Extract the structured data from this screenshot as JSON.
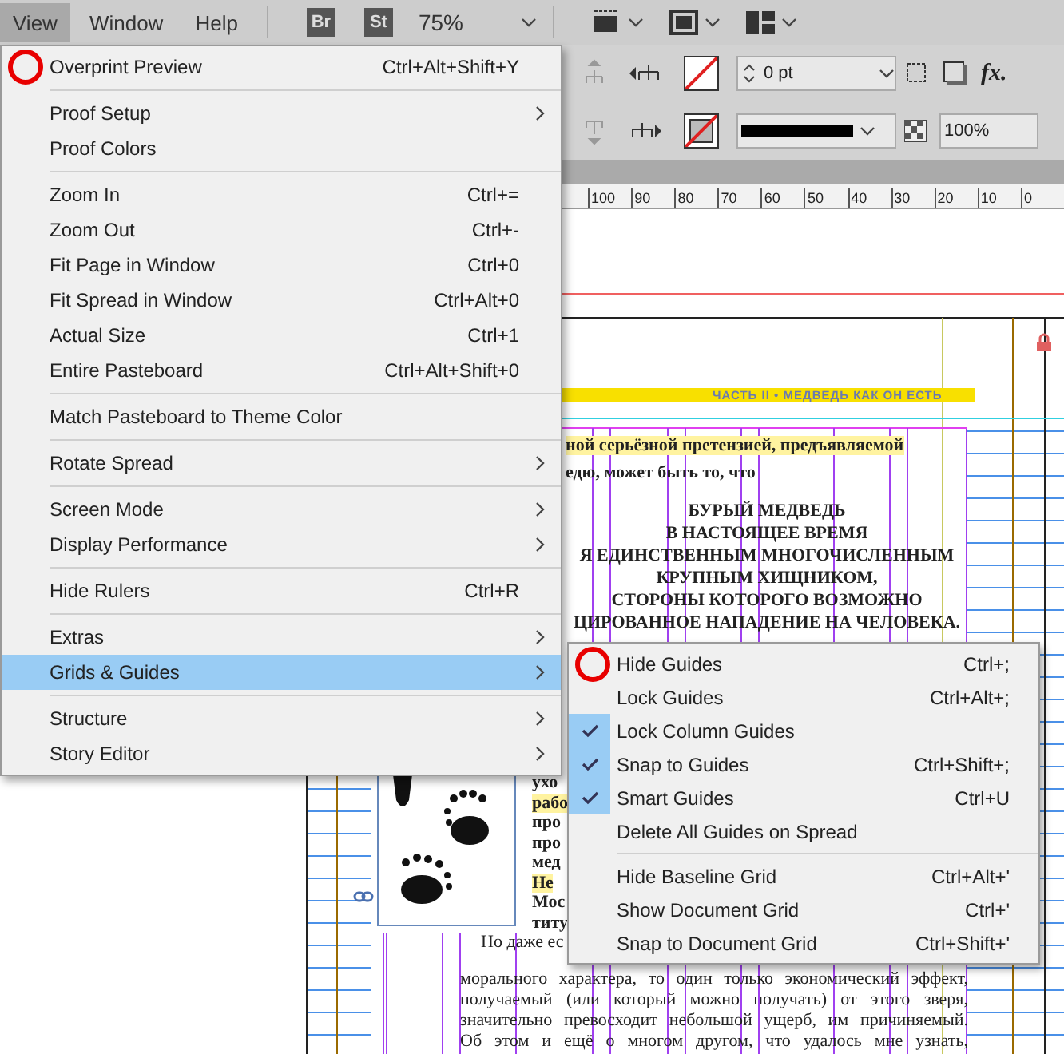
{
  "menubar": [
    {
      "label": "View",
      "selected": true
    },
    {
      "label": "Window",
      "selected": false
    },
    {
      "label": "Help",
      "selected": false
    }
  ],
  "app_bar": {
    "bridge": "Br",
    "stock": "St",
    "zoom": "75%"
  },
  "control_panel": {
    "stroke_weight": "0 pt",
    "opacity": "100%",
    "effects": "fx."
  },
  "ruler": [
    "100",
    "90",
    "80",
    "70",
    "60",
    "50",
    "40",
    "30",
    "20",
    "10",
    "0"
  ],
  "document": {
    "running_head": "ЧАСТЬ II • МЕДВЕДЬ КАК ОН ЕСТЬ",
    "lines": [
      {
        "text": "ной серьёзной претензией, предъявляемой",
        "kind": "para",
        "highlighted": true
      },
      {
        "text": "едю, может быть то, что",
        "kind": "para",
        "highlighted": false
      },
      {
        "text": "БУРЫЙ МЕДВЕДЬ",
        "kind": "heading",
        "highlighted": false
      },
      {
        "text": "В НАСТОЯЩЕЕ ВРЕМЯ",
        "kind": "heading",
        "highlighted": false
      },
      {
        "text": "Я ЕДИНСТВЕННЫМ МНОГОЧИСЛЕННЫМ",
        "kind": "heading",
        "highlighted": false
      },
      {
        "text": "КРУПНЫМ ХИЩНИКОМ,",
        "kind": "heading",
        "highlighted": false
      },
      {
        "text": "СТОРОНЫ КОТОРОГО ВОЗМОЖНО",
        "kind": "heading",
        "highlighted": false
      },
      {
        "text": "ЦИРОВАННОЕ НАПАДЕНИЕ НА ЧЕЛОВЕКА.",
        "kind": "heading",
        "highlighted": false
      }
    ],
    "side_fragments": [
      {
        "text": "ухо",
        "highlighted": false
      },
      {
        "text": "рабо",
        "highlighted": true
      },
      {
        "text": "про",
        "highlighted": false
      },
      {
        "text": "про",
        "highlighted": false
      },
      {
        "text": "мед",
        "highlighted": false
      },
      {
        "text": "Не",
        "highlighted": true
      },
      {
        "text": "Мос",
        "highlighted": false
      },
      {
        "text": "титу",
        "highlighted": false
      }
    ],
    "bottom_lines": [
      "Но даже ес",
      "морального характера, то один только экономический эффект,",
      "получаемый (или который можно получать) от этого зверя,",
      "значительно превосходит небольшой ущерб, им причиняемый.",
      "Об этом и ещё о многом другом, что удалось мне узнать,"
    ]
  },
  "view_menu": {
    "groups": [
      {
        "items": [
          {
            "label": "Overprint Preview",
            "shortcut": "Ctrl+Alt+Shift+Y",
            "submenu": false,
            "selected": false,
            "circled": true
          }
        ]
      },
      {
        "items": [
          {
            "label": "Proof Setup",
            "submenu": true,
            "selected": false,
            "circled": false
          },
          {
            "label": "Proof Colors",
            "submenu": false,
            "selected": false,
            "circled": false
          }
        ]
      },
      {
        "items": [
          {
            "label": "Zoom In",
            "shortcut": "Ctrl+=",
            "submenu": false,
            "selected": false,
            "circled": false
          },
          {
            "label": "Zoom Out",
            "shortcut": "Ctrl+-",
            "submenu": false,
            "selected": false,
            "circled": false
          },
          {
            "label": "Fit Page in Window",
            "shortcut": "Ctrl+0",
            "submenu": false,
            "selected": false,
            "circled": false
          },
          {
            "label": "Fit Spread in Window",
            "shortcut": "Ctrl+Alt+0",
            "submenu": false,
            "selected": false,
            "circled": false
          },
          {
            "label": "Actual Size",
            "shortcut": "Ctrl+1",
            "submenu": false,
            "selected": false,
            "circled": false
          },
          {
            "label": "Entire Pasteboard",
            "shortcut": "Ctrl+Alt+Shift+0",
            "submenu": false,
            "selected": false,
            "circled": false
          }
        ]
      },
      {
        "items": [
          {
            "label": "Match Pasteboard to Theme Color",
            "submenu": false,
            "selected": false,
            "circled": false
          }
        ]
      },
      {
        "items": [
          {
            "label": "Rotate Spread",
            "submenu": true,
            "selected": false,
            "circled": false
          }
        ]
      },
      {
        "items": [
          {
            "label": "Screen Mode",
            "submenu": true,
            "selected": false,
            "circled": false
          },
          {
            "label": "Display Performance",
            "submenu": true,
            "selected": false,
            "circled": false
          }
        ]
      },
      {
        "items": [
          {
            "label": "Hide Rulers",
            "shortcut": "Ctrl+R",
            "submenu": false,
            "selected": false,
            "circled": false
          }
        ]
      },
      {
        "items": [
          {
            "label": "Extras",
            "submenu": true,
            "selected": false,
            "circled": false
          },
          {
            "label": "Grids & Guides",
            "submenu": true,
            "selected": true,
            "circled": false
          }
        ]
      },
      {
        "items": [
          {
            "label": "Structure",
            "submenu": true,
            "selected": false,
            "circled": false
          },
          {
            "label": "Story Editor",
            "submenu": true,
            "selected": false,
            "circled": false
          }
        ]
      }
    ]
  },
  "guides_submenu": {
    "groups": [
      {
        "items": [
          {
            "label": "Hide Guides",
            "shortcut": "Ctrl+;",
            "checked": false,
            "circled": true
          },
          {
            "label": "Lock Guides",
            "shortcut": "Ctrl+Alt+;",
            "checked": false,
            "circled": false
          },
          {
            "label": "Lock Column Guides",
            "checked": true,
            "circled": false
          },
          {
            "label": "Snap to Guides",
            "shortcut": "Ctrl+Shift+;",
            "checked": true,
            "circled": false
          },
          {
            "label": "Smart Guides",
            "shortcut": "Ctrl+U",
            "checked": true,
            "circled": false
          },
          {
            "label": "Delete All Guides on Spread",
            "checked": false,
            "circled": false
          }
        ]
      },
      {
        "items": [
          {
            "label": "Hide Baseline Grid",
            "shortcut": "Ctrl+Alt+'",
            "checked": false,
            "circled": false
          },
          {
            "label": "Show Document Grid",
            "shortcut": "Ctrl+'",
            "checked": false,
            "circled": false
          },
          {
            "label": "Snap to Document Grid",
            "shortcut": "Ctrl+Shift+'",
            "checked": false,
            "circled": false
          }
        ]
      }
    ]
  }
}
